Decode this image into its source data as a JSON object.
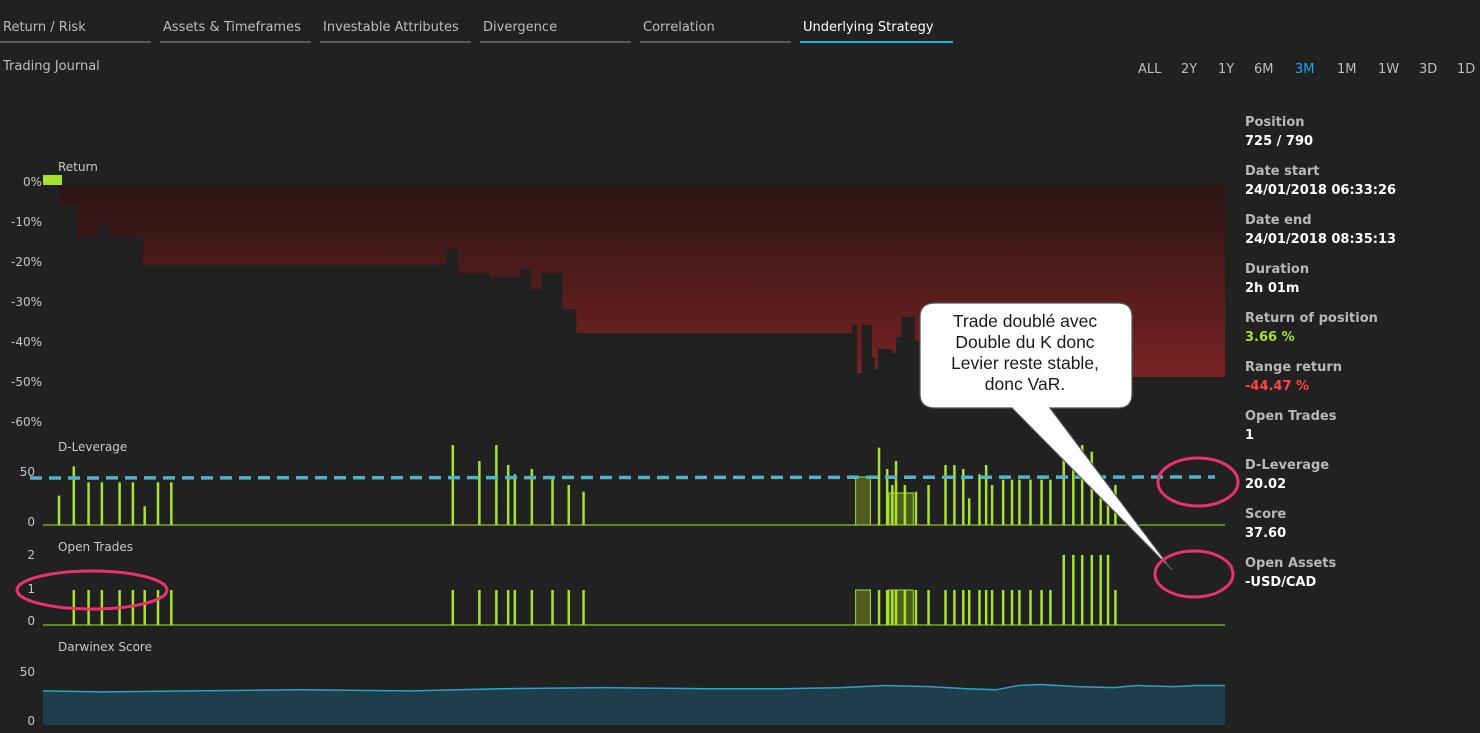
{
  "tabs": [
    {
      "label": "Return / Risk",
      "active": false
    },
    {
      "label": "Assets & Timeframes",
      "active": false
    },
    {
      "label": "Investable Attributes",
      "active": false
    },
    {
      "label": "Divergence",
      "active": false
    },
    {
      "label": "Correlation",
      "active": false
    },
    {
      "label": "Underlying Strategy",
      "active": true
    }
  ],
  "subtitle": "Trading Journal",
  "timeframes": [
    {
      "label": "ALL",
      "active": false
    },
    {
      "label": "2Y",
      "active": false
    },
    {
      "label": "1Y",
      "active": false
    },
    {
      "label": "6M",
      "active": false
    },
    {
      "label": "3M",
      "active": true
    },
    {
      "label": "1M",
      "active": false
    },
    {
      "label": "1W",
      "active": false
    },
    {
      "label": "3D",
      "active": false
    },
    {
      "label": "1D",
      "active": false
    }
  ],
  "info": [
    {
      "label": "Position",
      "value": "725 / 790",
      "tone": "normal"
    },
    {
      "label": "Date start",
      "value": "24/01/2018 06:33:26",
      "tone": "normal"
    },
    {
      "label": "Date end",
      "value": "24/01/2018 08:35:13",
      "tone": "normal"
    },
    {
      "label": "Duration",
      "value": "2h 01m",
      "tone": "normal"
    },
    {
      "label": "Return of position",
      "value": "3.66 %",
      "tone": "pos"
    },
    {
      "label": "Range return",
      "value": "-44.47 %",
      "tone": "neg"
    },
    {
      "label": "Open Trades",
      "value": "1",
      "tone": "normal"
    },
    {
      "label": "D-Leverage",
      "value": "20.02",
      "tone": "normal"
    },
    {
      "label": "Score",
      "value": "37.60",
      "tone": "normal"
    },
    {
      "label": "Open Assets",
      "value": "-USD/CAD",
      "tone": "normal"
    }
  ],
  "callout": {
    "lines": [
      "Trade doublé avec",
      "Double du K donc",
      "Levier reste stable,",
      "donc VaR."
    ]
  },
  "colors": {
    "accent": "#1ab3e0",
    "bars": "#a6e22e",
    "return_fill": "#7a1e1e",
    "score_fill": "#1f3d4a",
    "score_line": "#2aa3c7",
    "annotation": "#e8336e",
    "dashed": "#4fb3cf"
  },
  "chart_data": [
    {
      "type": "area",
      "title": "Return",
      "ylabel": "",
      "yticks": [
        "0%",
        "-10%",
        "-20%",
        "-30%",
        "-40%",
        "-50%",
        "-60%"
      ],
      "ylim": [
        -60,
        0
      ],
      "x_index_range": [
        0,
        790
      ],
      "series": [
        {
          "values": [
            [
              0,
              2
            ],
            [
              20,
              2
            ],
            [
              22,
              -5
            ],
            [
              40,
              -5
            ],
            [
              45,
              -13
            ],
            [
              70,
              -13
            ],
            [
              74,
              -10
            ],
            [
              85,
              -10
            ],
            [
              90,
              -13
            ],
            [
              130,
              -13
            ],
            [
              135,
              -20
            ],
            [
              542,
              -20
            ],
            [
              545,
              -16
            ],
            [
              558,
              -16
            ],
            [
              562,
              -22
            ],
            [
              600,
              -22
            ],
            [
              605,
              -23
            ],
            [
              640,
              -23
            ],
            [
              645,
              -21
            ],
            [
              655,
              -21
            ],
            [
              660,
              -26
            ],
            [
              675,
              -22
            ],
            [
              700,
              -22
            ],
            [
              703,
              -31
            ],
            [
              720,
              -31
            ],
            [
              722,
              -37
            ],
            [
              1090,
              -37
            ],
            [
              1095,
              -35
            ],
            [
              1100,
              -35
            ],
            [
              1102,
              -47
            ],
            [
              1108,
              -35
            ],
            [
              1120,
              -35
            ],
            [
              1122,
              -43
            ],
            [
              1126,
              -46
            ],
            [
              1130,
              -41
            ],
            [
              1150,
              -42
            ],
            [
              1155,
              -38
            ],
            [
              1162,
              -33
            ],
            [
              1175,
              -33
            ],
            [
              1180,
              -39
            ],
            [
              1190,
              -40
            ],
            [
              1195,
              -44
            ],
            [
              1200,
              -43
            ],
            [
              1215,
              -43
            ],
            [
              1220,
              -41
            ],
            [
              1228,
              -40
            ],
            [
              1238,
              -44
            ],
            [
              1245,
              -41
            ],
            [
              1250,
              -42
            ],
            [
              1255,
              -52
            ],
            [
              1262,
              -55
            ],
            [
              1266,
              -48
            ],
            [
              1272,
              -56
            ],
            [
              1278,
              -49
            ],
            [
              1290,
              -48
            ]
          ]
        }
      ]
    },
    {
      "type": "bar",
      "title": "D-Leverage",
      "yticks": [
        "50",
        "0"
      ],
      "ylim": [
        0,
        60
      ],
      "reference_value": 45,
      "series": [
        {
          "values": [
            [
              20,
              22
            ],
            [
              40,
              44
            ],
            [
              60,
              32
            ],
            [
              78,
              32
            ],
            [
              102,
              32
            ],
            [
              120,
              32
            ],
            [
              136,
              14
            ],
            [
              154,
              32
            ],
            [
              172,
              32
            ],
            [
              553,
              60
            ],
            [
              589,
              48
            ],
            [
              612,
              65
            ],
            [
              628,
              45
            ],
            [
              637,
              38
            ],
            [
              660,
              42
            ],
            [
              688,
              36
            ],
            [
              710,
              30
            ],
            [
              730,
              25
            ],
            [
              1130,
              58
            ],
            [
              1141,
              42
            ],
            [
              1148,
              30
            ],
            [
              1153,
              48
            ],
            [
              1165,
              30
            ],
            [
              1180,
              25
            ],
            [
              1197,
              30
            ],
            [
              1220,
              45
            ],
            [
              1232,
              45
            ],
            [
              1244,
              42
            ],
            [
              1252,
              20
            ],
            [
              1266,
              38
            ],
            [
              1275,
              45
            ],
            [
              1283,
              30
            ],
            [
              1298,
              34
            ],
            [
              1310,
              34
            ],
            [
              1320,
              34
            ],
            [
              1335,
              34
            ],
            [
              1350,
              34
            ],
            [
              1362,
              34
            ],
            [
              1380,
              55
            ],
            [
              1393,
              52
            ],
            [
              1405,
              60
            ],
            [
              1418,
              55
            ],
            [
              1430,
              30
            ],
            [
              1440,
              30
            ],
            [
              1450,
              30
            ]
          ]
        }
      ],
      "blocks": [
        [
          1100,
          1120,
          36
        ],
        [
          1145,
          1178,
          24
        ]
      ]
    },
    {
      "type": "bar",
      "title": "Open Trades",
      "yticks": [
        "2",
        "1",
        "0"
      ],
      "ylim": [
        0,
        2
      ],
      "series": [
        {
          "values": [
            [
              40,
              1
            ],
            [
              60,
              1
            ],
            [
              78,
              1
            ],
            [
              102,
              1
            ],
            [
              120,
              1
            ],
            [
              136,
              1
            ],
            [
              154,
              1
            ],
            [
              172,
              1
            ],
            [
              553,
              1
            ],
            [
              589,
              1
            ],
            [
              612,
              1
            ],
            [
              628,
              1
            ],
            [
              637,
              1
            ],
            [
              660,
              1
            ],
            [
              688,
              1
            ],
            [
              710,
              1
            ],
            [
              730,
              1
            ],
            [
              1130,
              1
            ],
            [
              1141,
              1
            ],
            [
              1148,
              1
            ],
            [
              1153,
              1
            ],
            [
              1165,
              1
            ],
            [
              1180,
              1
            ],
            [
              1197,
              1
            ],
            [
              1220,
              1
            ],
            [
              1232,
              1
            ],
            [
              1244,
              1
            ],
            [
              1252,
              1
            ],
            [
              1266,
              1
            ],
            [
              1275,
              1
            ],
            [
              1283,
              1
            ],
            [
              1298,
              1
            ],
            [
              1310,
              1
            ],
            [
              1320,
              1
            ],
            [
              1335,
              1
            ],
            [
              1350,
              1
            ],
            [
              1362,
              1
            ],
            [
              1380,
              2
            ],
            [
              1393,
              2
            ],
            [
              1405,
              2
            ],
            [
              1418,
              2
            ],
            [
              1430,
              2
            ],
            [
              1440,
              2
            ],
            [
              1450,
              1
            ]
          ]
        }
      ]
    },
    {
      "type": "area",
      "title": "Darwinex Score",
      "yticks": [
        "50",
        "0"
      ],
      "ylim": [
        0,
        50
      ],
      "series": [
        {
          "values": [
            [
              0,
              32
            ],
            [
              80,
              31
            ],
            [
              200,
              32
            ],
            [
              350,
              33
            ],
            [
              500,
              32
            ],
            [
              620,
              34
            ],
            [
              760,
              35
            ],
            [
              900,
              34
            ],
            [
              1000,
              34
            ],
            [
              1080,
              35
            ],
            [
              1140,
              37
            ],
            [
              1200,
              36
            ],
            [
              1250,
              34
            ],
            [
              1290,
              33
            ],
            [
              1320,
              37
            ],
            [
              1350,
              38
            ],
            [
              1400,
              36
            ],
            [
              1450,
              35
            ],
            [
              1480,
              37
            ],
            [
              1530,
              36
            ],
            [
              1560,
              37
            ],
            [
              1600,
              37
            ]
          ]
        }
      ]
    }
  ]
}
